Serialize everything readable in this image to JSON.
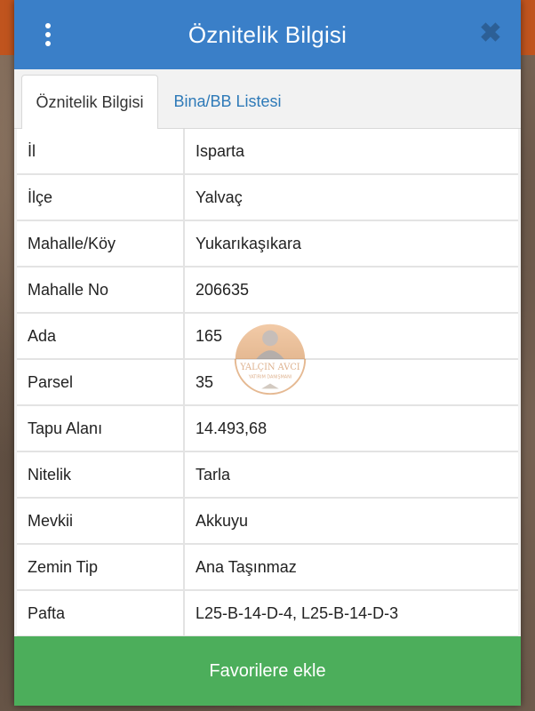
{
  "header": {
    "title": "Öznitelik Bilgisi",
    "menu_icon": "kebab-menu-icon",
    "close_icon": "close-icon",
    "color": "#3a7fc8"
  },
  "tabs": [
    {
      "label": "Öznitelik Bilgisi",
      "active": true
    },
    {
      "label": "Bina/BB Listesi",
      "active": false
    }
  ],
  "rows": [
    {
      "label": "İl",
      "value": "Isparta"
    },
    {
      "label": "İlçe",
      "value": "Yalvaç"
    },
    {
      "label": "Mahalle/Köy",
      "value": "Yukarıkaşıkara"
    },
    {
      "label": "Mahalle No",
      "value": "206635"
    },
    {
      "label": "Ada",
      "value": "165"
    },
    {
      "label": "Parsel",
      "value": "35"
    },
    {
      "label": "Tapu Alanı",
      "value": "14.493,68"
    },
    {
      "label": "Nitelik",
      "value": "Tarla"
    },
    {
      "label": "Mevkii",
      "value": "Akkuyu"
    },
    {
      "label": "Zemin Tip",
      "value": "Ana Taşınmaz"
    },
    {
      "label": "Pafta",
      "value": "L25-B-14-D-4, L25-B-14-D-3"
    }
  ],
  "watermark": {
    "name": "YALÇIN AVCI",
    "subtitle": "YATIRIM DANIŞMANI"
  },
  "footer": {
    "favorite_label": "Favorilere ekle",
    "color": "#4cae5b"
  }
}
